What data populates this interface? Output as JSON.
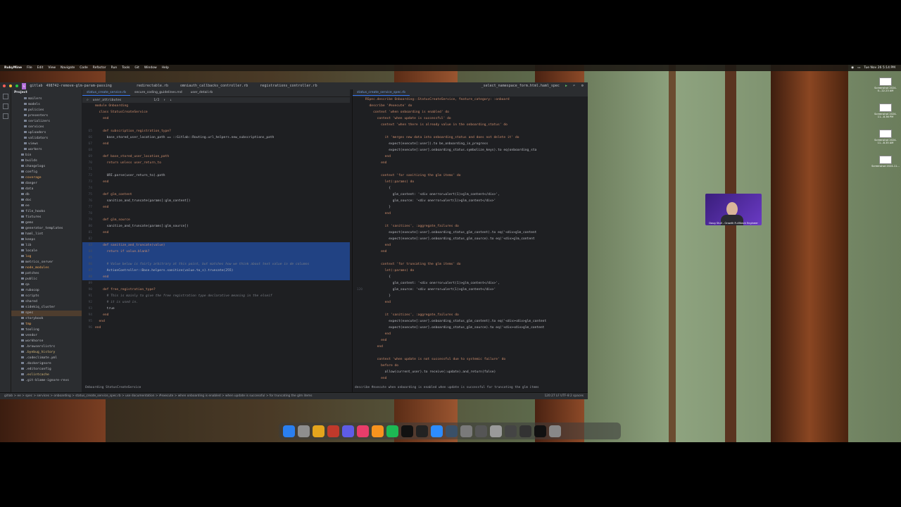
{
  "menubar": {
    "app": "RubyMine",
    "items": [
      "File",
      "Edit",
      "View",
      "Navigate",
      "Code",
      "Refactor",
      "Run",
      "Tools",
      "Git",
      "Window",
      "Help"
    ],
    "clock": "Tue Nov 26  5:14 PM"
  },
  "titlebar": {
    "project": "gitlab",
    "branch": "498742-remove-glm-param-passing",
    "tabs_left": [
      "redirectable.rb",
      "omniauth_callbacks_controller.rb",
      "registrations_controller.rb"
    ],
    "tabs_left2": [
      "status_create_service.rb",
      "secure_coding_guidelines.md",
      "user_detail.rb"
    ],
    "tabs_right": [
      "status_create_service_spec.rb"
    ],
    "run_config": "_select_namespace_form.html.haml_spec"
  },
  "project_panel": {
    "title": "Project",
    "items": [
      {
        "label": "mailers",
        "cls": ""
      },
      {
        "label": "models",
        "cls": ""
      },
      {
        "label": "policies",
        "cls": ""
      },
      {
        "label": "presenters",
        "cls": ""
      },
      {
        "label": "serializers",
        "cls": ""
      },
      {
        "label": "services",
        "cls": ""
      },
      {
        "label": "uploaders",
        "cls": ""
      },
      {
        "label": "validators",
        "cls": ""
      },
      {
        "label": "views",
        "cls": ""
      },
      {
        "label": "workers",
        "cls": ""
      },
      {
        "label": "bin",
        "cls": ""
      },
      {
        "label": "builds",
        "cls": ""
      },
      {
        "label": "changelogs",
        "cls": ""
      },
      {
        "label": "config",
        "cls": ""
      },
      {
        "label": "coverage",
        "cls": "ex"
      },
      {
        "label": "danger",
        "cls": ""
      },
      {
        "label": "data",
        "cls": ""
      },
      {
        "label": "db",
        "cls": ""
      },
      {
        "label": "doc",
        "cls": ""
      },
      {
        "label": "ee",
        "cls": ""
      },
      {
        "label": "file_hooks",
        "cls": ""
      },
      {
        "label": "fixtures",
        "cls": ""
      },
      {
        "label": "gems",
        "cls": ""
      },
      {
        "label": "generator_templates",
        "cls": ""
      },
      {
        "label": "haml_lint",
        "cls": ""
      },
      {
        "label": "keeps",
        "cls": ""
      },
      {
        "label": "lib",
        "cls": ""
      },
      {
        "label": "locale",
        "cls": ""
      },
      {
        "label": "log",
        "cls": "ex"
      },
      {
        "label": "metrics_server",
        "cls": ""
      },
      {
        "label": "node_modules",
        "cls": "ex"
      },
      {
        "label": "patches",
        "cls": ""
      },
      {
        "label": "public",
        "cls": ""
      },
      {
        "label": "qa",
        "cls": ""
      },
      {
        "label": "rubocop",
        "cls": ""
      },
      {
        "label": "scripts",
        "cls": ""
      },
      {
        "label": "shared",
        "cls": ""
      },
      {
        "label": "sidekiq_cluster",
        "cls": ""
      },
      {
        "label": "spec",
        "cls": "hl"
      },
      {
        "label": "storybook",
        "cls": ""
      },
      {
        "label": "tmp",
        "cls": "ex"
      },
      {
        "label": "tooling",
        "cls": ""
      },
      {
        "label": "vendor",
        "cls": ""
      },
      {
        "label": "workhorse",
        "cls": ""
      },
      {
        "label": ".browserslistrc",
        "cls": ""
      },
      {
        "label": ".byebug_history",
        "cls": "yl"
      },
      {
        "label": ".codeclimate.yml",
        "cls": ""
      },
      {
        "label": ".dockerignore",
        "cls": ""
      },
      {
        "label": ".editorconfig",
        "cls": ""
      },
      {
        "label": ".eslintcache",
        "cls": "yl"
      },
      {
        "label": ".git-blame-ignore-revs",
        "cls": ""
      }
    ]
  },
  "left_editor": {
    "find_text": "user_attributes",
    "find_count": "1/2",
    "lines": [
      {
        "n": "",
        "t": "module Onboarding"
      },
      {
        "n": "",
        "t": "  class StatusCreateService"
      },
      {
        "n": "",
        "t": "    end"
      },
      {
        "n": "",
        "t": ""
      },
      {
        "n": "65",
        "t": "    def subscription_registration_type?"
      },
      {
        "n": "66",
        "t": "      base_stored_user_location_path == ::Gitlab::Routing.url_helpers.new_subscriptions_path"
      },
      {
        "n": "67",
        "t": "    end"
      },
      {
        "n": "68",
        "t": ""
      },
      {
        "n": "69",
        "t": "    def base_stored_user_location_path"
      },
      {
        "n": "70",
        "t": "      return unless user_return_to"
      },
      {
        "n": "71",
        "t": ""
      },
      {
        "n": "72",
        "t": "      URI.parse(user_return_to).path"
      },
      {
        "n": "73",
        "t": "    end"
      },
      {
        "n": "74",
        "t": ""
      },
      {
        "n": "75",
        "t": "    def glm_content"
      },
      {
        "n": "76",
        "t": "      sanitize_and_truncate(params[:glm_content])"
      },
      {
        "n": "77",
        "t": "    end"
      },
      {
        "n": "78",
        "t": ""
      },
      {
        "n": "79",
        "t": "    def glm_source"
      },
      {
        "n": "80",
        "t": "      sanitize_and_truncate(params[:glm_source])"
      },
      {
        "n": "81",
        "t": "    end"
      },
      {
        "n": "82",
        "t": ""
      },
      {
        "n": "83",
        "t": "    def sanitize_and_truncate(value)"
      },
      {
        "n": "84",
        "t": "      return if value.blank?"
      },
      {
        "n": "85",
        "t": ""
      },
      {
        "n": "86",
        "t": "      # Value below is fairly arbitrary at this point, but matches how we think about text value in de columns"
      },
      {
        "n": "87",
        "t": "      ActionController::Base.helpers.sanitize(value.to_s).truncate(255)"
      },
      {
        "n": "88",
        "t": "    end"
      },
      {
        "n": "89",
        "t": ""
      },
      {
        "n": "90",
        "t": "    def free_registration_type?"
      },
      {
        "n": "91",
        "t": "      # This is mainly to give the free registration type declarative meaning in the elseif"
      },
      {
        "n": "92",
        "t": "      # it is used in."
      },
      {
        "n": "93",
        "t": "      true"
      },
      {
        "n": "94",
        "t": "    end"
      },
      {
        "n": "95",
        "t": "  end"
      },
      {
        "n": "96",
        "t": "end"
      }
    ],
    "breadcrumb": "Onboarding  StatusCreateService"
  },
  "right_editor": {
    "lines": [
      {
        "n": "",
        "t": "RSpec.describe Onboarding::StatusCreateService, feature_category: :onboard"
      },
      {
        "n": "",
        "t": "  describe '#execute' do"
      },
      {
        "n": "",
        "t": "    context 'when onboarding is enabled' do"
      },
      {
        "n": "",
        "t": "      context 'when update is successful' do"
      },
      {
        "n": "",
        "t": "        context 'when there is already value in the onboarding_status' do"
      },
      {
        "n": "",
        "t": ""
      },
      {
        "n": "",
        "t": "          it 'merges new data into onboarding_status and does not delete it' do"
      },
      {
        "n": "",
        "t": "            expect(execute[:user]).to be_onboarding_in_progress"
      },
      {
        "n": "",
        "t": "            expect(execute[:user].onboarding_status.symbolize_keys).to eq(onboarding_sta"
      },
      {
        "n": "",
        "t": "          end"
      },
      {
        "n": "",
        "t": "        end"
      },
      {
        "n": "",
        "t": ""
      },
      {
        "n": "",
        "t": "        context 'for sanitizing the glm items' do"
      },
      {
        "n": "",
        "t": "          let(:params) do"
      },
      {
        "n": "",
        "t": "            {"
      },
      {
        "n": "",
        "t": "              glm_content: '<div onerror=alert(1)>glm_content</div>',"
      },
      {
        "n": "",
        "t": "              glm_source: '<div onerror=alert(1)>glm_content</div>'"
      },
      {
        "n": "",
        "t": "            }"
      },
      {
        "n": "",
        "t": "          end"
      },
      {
        "n": "",
        "t": ""
      },
      {
        "n": "",
        "t": "          it 'sanitizes', :aggregate_failures do"
      },
      {
        "n": "",
        "t": "            expect(execute[:user].onboarding_status_glm_content).to eq('<div>glm_content"
      },
      {
        "n": "",
        "t": "            expect(execute[:user].onboarding_status_glm_source).to eq('<div>glm_content"
      },
      {
        "n": "",
        "t": "          end"
      },
      {
        "n": "",
        "t": "        end"
      },
      {
        "n": "",
        "t": ""
      },
      {
        "n": "",
        "t": "        context 'for truncating the glm items' do"
      },
      {
        "n": "",
        "t": "          let(:params) do"
      },
      {
        "n": "",
        "t": "            {"
      },
      {
        "n": "",
        "t": "              glm_content: '<div onerror=alert(1)>glm_content</div>',"
      },
      {
        "n": "120",
        "t": "              glm_source: '<div onerror=alert(1)>glm_content</div>'"
      },
      {
        "n": "",
        "t": "            }"
      },
      {
        "n": "",
        "t": "          end"
      },
      {
        "n": "",
        "t": ""
      },
      {
        "n": "",
        "t": "          it 'sanitizes', :aggregate_failures do"
      },
      {
        "n": "",
        "t": "            expect(execute[:user].onboarding_status_glm_content).to eq('<div><div>glm_content"
      },
      {
        "n": "",
        "t": "            expect(execute[:user].onboarding_status_glm_source).to eq('<div><div>glm_content"
      },
      {
        "n": "",
        "t": "          end"
      },
      {
        "n": "",
        "t": "        end"
      },
      {
        "n": "",
        "t": "      end"
      },
      {
        "n": "",
        "t": ""
      },
      {
        "n": "",
        "t": "      context 'when update is not successful due to systemic failure' do"
      },
      {
        "n": "",
        "t": "        before do"
      },
      {
        "n": "",
        "t": "          allow(current_user).to receive(:update).and_return(false)"
      },
      {
        "n": "",
        "t": "        end"
      }
    ],
    "breadcrumb": "describe  #execute  when onboarding is enabled  when update is successful  for truncating the glm items"
  },
  "statusbar": {
    "path": "gitlab > ee > spec > services > onboarding > status_create_service_spec.rb > use documentation > #execute > when onboarding is enabled > when update is successful > for truncating the glm items",
    "right": "120:27   LF   UTF-8   2 spaces"
  },
  "webcam": {
    "caption": "Doug Stull - Growth FullStack Engineer"
  },
  "desktop_shots": [
    "Screenshot 2024-0...22.23 AM",
    "Screenshot 2024-11...8.36 PM",
    "Screenshot 2024-11...8.35 AM",
    "Screenshot 2024-11..."
  ],
  "dock_colors": [
    "#2a7ff0",
    "#8e8e8e",
    "#e4a41d",
    "#c0392b",
    "#5e5ce6",
    "#e83d6a",
    "#f7931e",
    "#1db954",
    "#111111",
    "#222222",
    "#2d8cff",
    "#3a5068",
    "#7a7a7a",
    "#555555",
    "#9a9a9a",
    "#444444",
    "#333333",
    "#111111",
    "#888888"
  ]
}
